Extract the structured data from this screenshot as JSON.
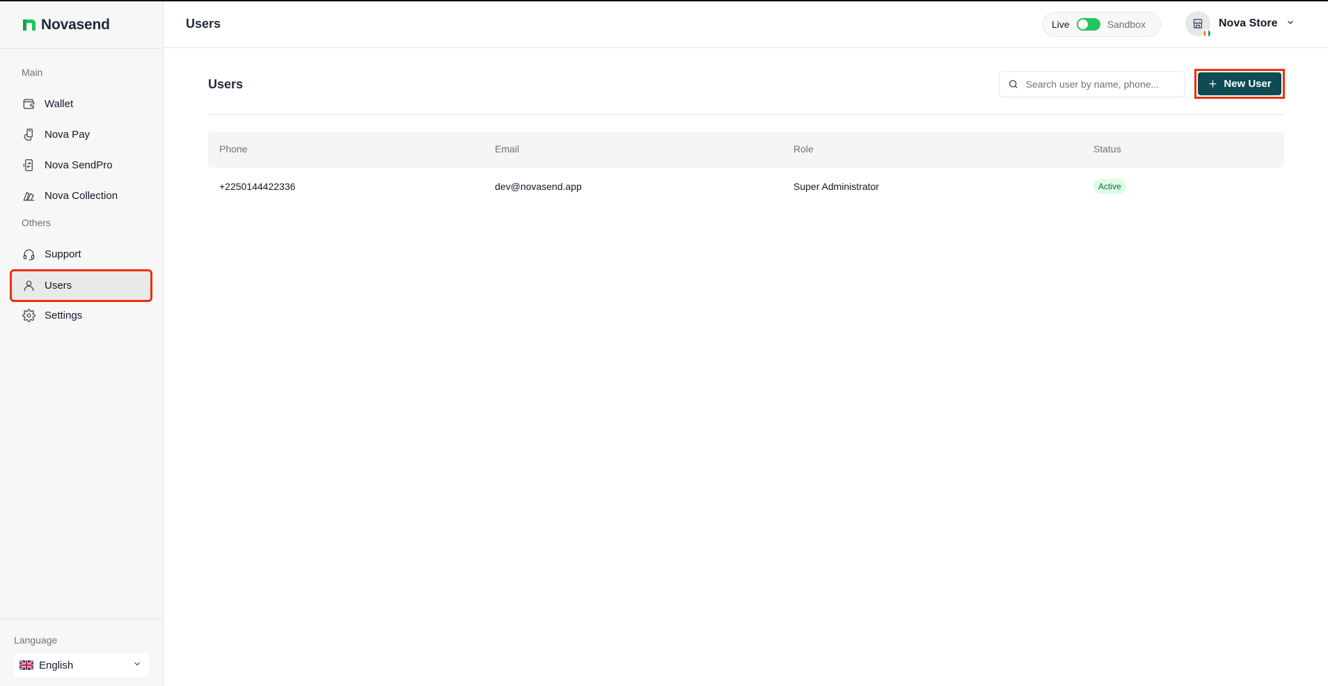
{
  "brand": {
    "name": "Novasend"
  },
  "sidebar": {
    "sections": [
      {
        "label": "Main"
      },
      {
        "label": "Others"
      }
    ],
    "items": [
      {
        "label": "Wallet",
        "icon": "wallet-icon"
      },
      {
        "label": "Nova Pay",
        "icon": "hand-phone-icon"
      },
      {
        "label": "Nova SendPro",
        "icon": "phone-transfer-icon"
      },
      {
        "label": "Nova Collection",
        "icon": "collection-icon"
      },
      {
        "label": "Support",
        "icon": "headset-icon"
      },
      {
        "label": "Users",
        "icon": "user-icon",
        "active": true
      },
      {
        "label": "Settings",
        "icon": "gear-icon"
      }
    ],
    "language": {
      "label": "Language",
      "value": "English",
      "flag": "uk-flag-icon"
    }
  },
  "header": {
    "title": "Users",
    "env": {
      "live": "Live",
      "sandbox": "Sandbox",
      "toggle_on": true
    },
    "store": {
      "name": "Nova Store",
      "icon": "store-icon"
    }
  },
  "main": {
    "title": "Users",
    "search": {
      "placeholder": "Search user by name, phone...",
      "value": ""
    },
    "new_user_label": "New User",
    "table": {
      "columns": [
        "Phone",
        "Email",
        "Role",
        "Status"
      ],
      "rows": [
        {
          "phone": "+2250144422336",
          "email": "dev@novasend.app",
          "role": "Super Administrator",
          "status": "Active"
        }
      ]
    }
  },
  "colors": {
    "accent": "#0e4b54",
    "brand_green": "#22c55e",
    "highlight": "#ef2d0d",
    "active_badge_bg": "#dcfce7"
  }
}
